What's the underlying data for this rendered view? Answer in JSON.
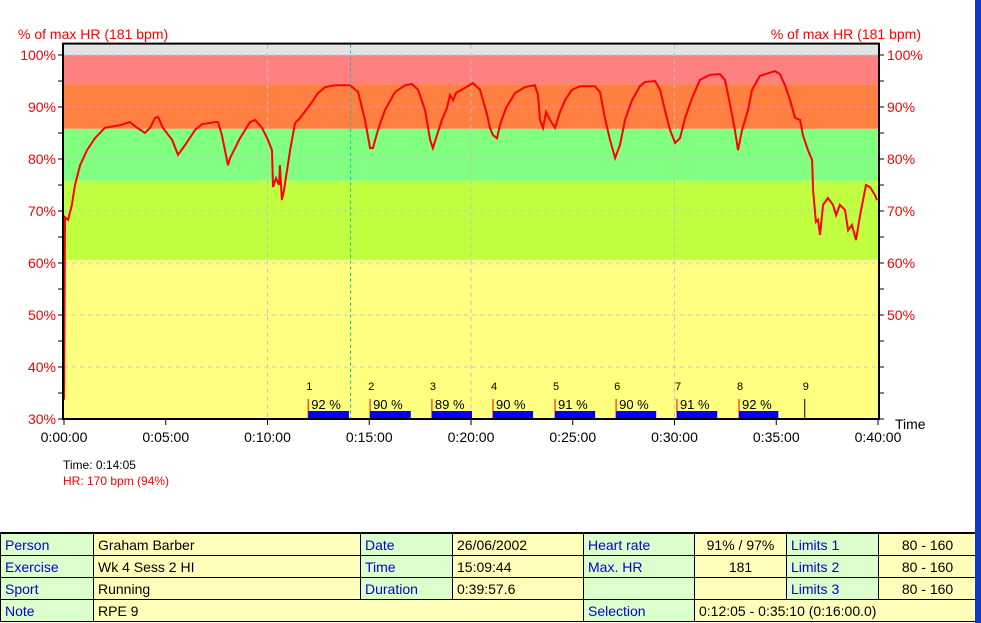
{
  "chart_data": {
    "type": "line",
    "ylabel_left": "% of max HR (181 bpm)",
    "ylabel_right": "% of max HR (181 bpm)",
    "xlabel": "Time",
    "xlim_minutes": [
      0,
      40
    ],
    "ylim_percent": [
      30,
      102
    ],
    "x_ticks": [
      "0:00:00",
      "0:05:00",
      "0:10:00",
      "0:15:00",
      "0:20:00",
      "0:25:00",
      "0:30:00",
      "0:35:00",
      "0:40:00"
    ],
    "y_ticks_left": [
      "30%",
      "40%",
      "50%",
      "60%",
      "70%",
      "80%",
      "90%",
      "100%"
    ],
    "y_ticks_right": [
      "50%",
      "60%",
      "70%",
      "80%",
      "90%",
      "100%"
    ],
    "grid": true,
    "zones": [
      {
        "from": 100,
        "to": 102,
        "color": "#e4e4e4"
      },
      {
        "from": 94.4,
        "to": 100,
        "color": "#ff8080"
      },
      {
        "from": 85.8,
        "to": 94.4,
        "color": "#ff8040"
      },
      {
        "from": 75.8,
        "to": 85.8,
        "color": "#80ff80"
      },
      {
        "from": 60.6,
        "to": 75.8,
        "color": "#c0ff40"
      },
      {
        "from": 30,
        "to": 60.6,
        "color": "#ffff80"
      }
    ],
    "line_color": "#ff0000",
    "cursor_minutes": 14.08,
    "series": [
      {
        "points": [
          [
            0,
            33.7
          ],
          [
            0.05,
            68.8
          ],
          [
            0.2,
            68.3
          ],
          [
            0.39,
            71.2
          ],
          [
            0.54,
            75.0
          ],
          [
            0.79,
            78.8
          ],
          [
            1.13,
            81.7
          ],
          [
            1.52,
            84.0
          ],
          [
            2.01,
            86.0
          ],
          [
            2.75,
            86.5
          ],
          [
            3.24,
            87.1
          ],
          [
            3.59,
            86.0
          ],
          [
            3.98,
            85.0
          ],
          [
            4.23,
            86.0
          ],
          [
            4.47,
            87.9
          ],
          [
            4.62,
            88.1
          ],
          [
            4.86,
            86.0
          ],
          [
            5.31,
            83.7
          ],
          [
            5.6,
            80.8
          ],
          [
            5.95,
            82.7
          ],
          [
            6.44,
            85.6
          ],
          [
            6.78,
            86.7
          ],
          [
            7.42,
            87.1
          ],
          [
            7.57,
            87.1
          ],
          [
            7.76,
            84.6
          ],
          [
            8.06,
            78.8
          ],
          [
            8.16,
            80.2
          ],
          [
            8.65,
            84.0
          ],
          [
            9.14,
            87.1
          ],
          [
            9.39,
            87.5
          ],
          [
            9.73,
            86.0
          ],
          [
            10.02,
            83.7
          ],
          [
            10.22,
            81.7
          ],
          [
            10.27,
            74.6
          ],
          [
            10.42,
            76.3
          ],
          [
            10.57,
            75.0
          ],
          [
            10.61,
            78.8
          ],
          [
            10.71,
            72.1
          ],
          [
            10.81,
            74.0
          ],
          [
            11.11,
            81.7
          ],
          [
            11.35,
            86.9
          ],
          [
            11.6,
            87.9
          ],
          [
            12.09,
            90.4
          ],
          [
            12.48,
            92.7
          ],
          [
            12.83,
            93.8
          ],
          [
            13.32,
            94.2
          ],
          [
            14.05,
            94.2
          ],
          [
            14.45,
            92.9
          ],
          [
            14.79,
            87.5
          ],
          [
            15.04,
            82.1
          ],
          [
            15.18,
            82.1
          ],
          [
            15.43,
            85.6
          ],
          [
            15.77,
            89.4
          ],
          [
            16.27,
            92.9
          ],
          [
            16.76,
            94.2
          ],
          [
            17.1,
            94.4
          ],
          [
            17.4,
            93.3
          ],
          [
            17.74,
            89.4
          ],
          [
            17.99,
            83.7
          ],
          [
            18.13,
            82.1
          ],
          [
            18.33,
            84.6
          ],
          [
            18.57,
            87.5
          ],
          [
            18.82,
            89.8
          ],
          [
            18.97,
            92.3
          ],
          [
            19.12,
            91.3
          ],
          [
            19.26,
            92.7
          ],
          [
            19.71,
            93.7
          ],
          [
            20.1,
            94.6
          ],
          [
            20.44,
            93.3
          ],
          [
            20.79,
            88.5
          ],
          [
            20.93,
            86.0
          ],
          [
            21.08,
            84.6
          ],
          [
            21.28,
            84.0
          ],
          [
            21.42,
            86.5
          ],
          [
            21.72,
            89.8
          ],
          [
            22.16,
            92.7
          ],
          [
            22.65,
            93.8
          ],
          [
            23.14,
            94.2
          ],
          [
            23.29,
            92.3
          ],
          [
            23.39,
            87.5
          ],
          [
            23.54,
            86.0
          ],
          [
            23.69,
            89.0
          ],
          [
            23.88,
            87.5
          ],
          [
            24.13,
            86.0
          ],
          [
            24.37,
            89.0
          ],
          [
            24.62,
            91.3
          ],
          [
            24.96,
            93.3
          ],
          [
            25.36,
            94.0
          ],
          [
            26.09,
            94.0
          ],
          [
            26.34,
            92.9
          ],
          [
            26.58,
            87.9
          ],
          [
            26.83,
            83.7
          ],
          [
            27.08,
            80.2
          ],
          [
            27.32,
            82.7
          ],
          [
            27.57,
            87.5
          ],
          [
            27.91,
            91.3
          ],
          [
            28.3,
            94.0
          ],
          [
            28.55,
            94.8
          ],
          [
            29.04,
            95.0
          ],
          [
            29.29,
            93.3
          ],
          [
            29.53,
            89.4
          ],
          [
            29.78,
            85.6
          ],
          [
            30.03,
            83.1
          ],
          [
            30.27,
            84.0
          ],
          [
            30.52,
            87.9
          ],
          [
            30.86,
            91.7
          ],
          [
            31.25,
            95.2
          ],
          [
            31.74,
            96.2
          ],
          [
            32.24,
            96.3
          ],
          [
            32.48,
            95.2
          ],
          [
            32.73,
            90.4
          ],
          [
            32.97,
            85.6
          ],
          [
            33.12,
            81.7
          ],
          [
            33.32,
            85.6
          ],
          [
            33.61,
            89.4
          ],
          [
            33.81,
            93.3
          ],
          [
            34.2,
            96.0
          ],
          [
            34.94,
            96.9
          ],
          [
            35.18,
            96.3
          ],
          [
            35.43,
            94.2
          ],
          [
            35.68,
            91.3
          ],
          [
            35.92,
            87.9
          ],
          [
            36.17,
            87.5
          ],
          [
            36.31,
            84.6
          ],
          [
            36.56,
            81.7
          ],
          [
            36.76,
            79.8
          ],
          [
            36.81,
            74.0
          ],
          [
            36.95,
            67.9
          ],
          [
            37.05,
            68.3
          ],
          [
            37.15,
            65.4
          ],
          [
            37.3,
            71.2
          ],
          [
            37.54,
            72.5
          ],
          [
            37.79,
            71.2
          ],
          [
            37.94,
            69.2
          ],
          [
            38.13,
            71.2
          ],
          [
            38.38,
            70.2
          ],
          [
            38.53,
            66.3
          ],
          [
            38.72,
            67.3
          ],
          [
            38.92,
            64.4
          ],
          [
            39.12,
            69.2
          ],
          [
            39.41,
            75.0
          ],
          [
            39.61,
            74.6
          ],
          [
            39.85,
            73.1
          ],
          [
            39.95,
            72.1
          ]
        ]
      }
    ],
    "laps": [
      {
        "num": "1",
        "start": 12.0,
        "end": 14.0,
        "label": "92 %"
      },
      {
        "num": "2",
        "start": 15.04,
        "end": 17.04,
        "label": "90 %"
      },
      {
        "num": "3",
        "start": 18.08,
        "end": 20.05,
        "label": "89 %"
      },
      {
        "num": "4",
        "start": 21.08,
        "end": 23.05,
        "label": "90 %"
      },
      {
        "num": "5",
        "start": 24.13,
        "end": 26.1,
        "label": "91 %"
      },
      {
        "num": "6",
        "start": 27.13,
        "end": 29.1,
        "label": "90 %"
      },
      {
        "num": "7",
        "start": 30.12,
        "end": 32.1,
        "label": "91 %"
      },
      {
        "num": "8",
        "start": 33.17,
        "end": 35.1,
        "label": "92 %"
      },
      {
        "num": "9",
        "start": 36.4
      }
    ]
  },
  "cursor_info": {
    "time": "Time: 0:14:05",
    "hr": "HR: 170 bpm (94%)"
  },
  "table": {
    "person_label": "Person",
    "person": "Graham Barber",
    "date_label": "Date",
    "date": "26/06/2002",
    "hr_label": "Heart rate",
    "hr": "91% / 97%",
    "limits1_label": "Limits 1",
    "limits1": "80 - 160",
    "exercise_label": "Exercise",
    "exercise": "Wk 4 Sess 2 HI",
    "time_label": "Time",
    "time": "15:09:44",
    "maxhr_label": "Max. HR",
    "maxhr": "181",
    "limits2_label": "Limits 2",
    "limits2": "80 - 160",
    "sport_label": "Sport",
    "sport": "Running",
    "duration_label": "Duration",
    "duration": "0:39:57.6",
    "limits3_label": "Limits 3",
    "limits3": "80 - 160",
    "note_label": "Note",
    "note": "RPE 9",
    "selection_label": "Selection",
    "selection": "0:12:05 - 0:35:10 (0:16:00.0)"
  }
}
